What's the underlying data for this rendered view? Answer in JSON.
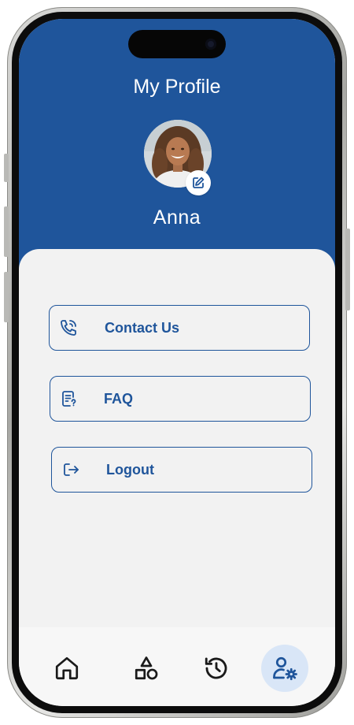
{
  "header": {
    "title": "My Profile",
    "user_name": "Anna"
  },
  "menu": {
    "items": [
      {
        "label": "Contact Us",
        "icon": "phone-icon"
      },
      {
        "label": "FAQ",
        "icon": "faq-document-icon"
      },
      {
        "label": "Logout",
        "icon": "logout-icon"
      }
    ]
  },
  "bottom_nav": {
    "items": [
      {
        "icon": "home-icon",
        "active": false
      },
      {
        "icon": "shapes-icon",
        "active": false
      },
      {
        "icon": "history-icon",
        "active": false
      },
      {
        "icon": "user-settings-icon",
        "active": true
      }
    ]
  },
  "colors": {
    "primary": "#1f559b",
    "background": "#f2f2f2",
    "nav_active_bg": "#d9e6f7",
    "nav_icon": "#1a1a1a"
  }
}
